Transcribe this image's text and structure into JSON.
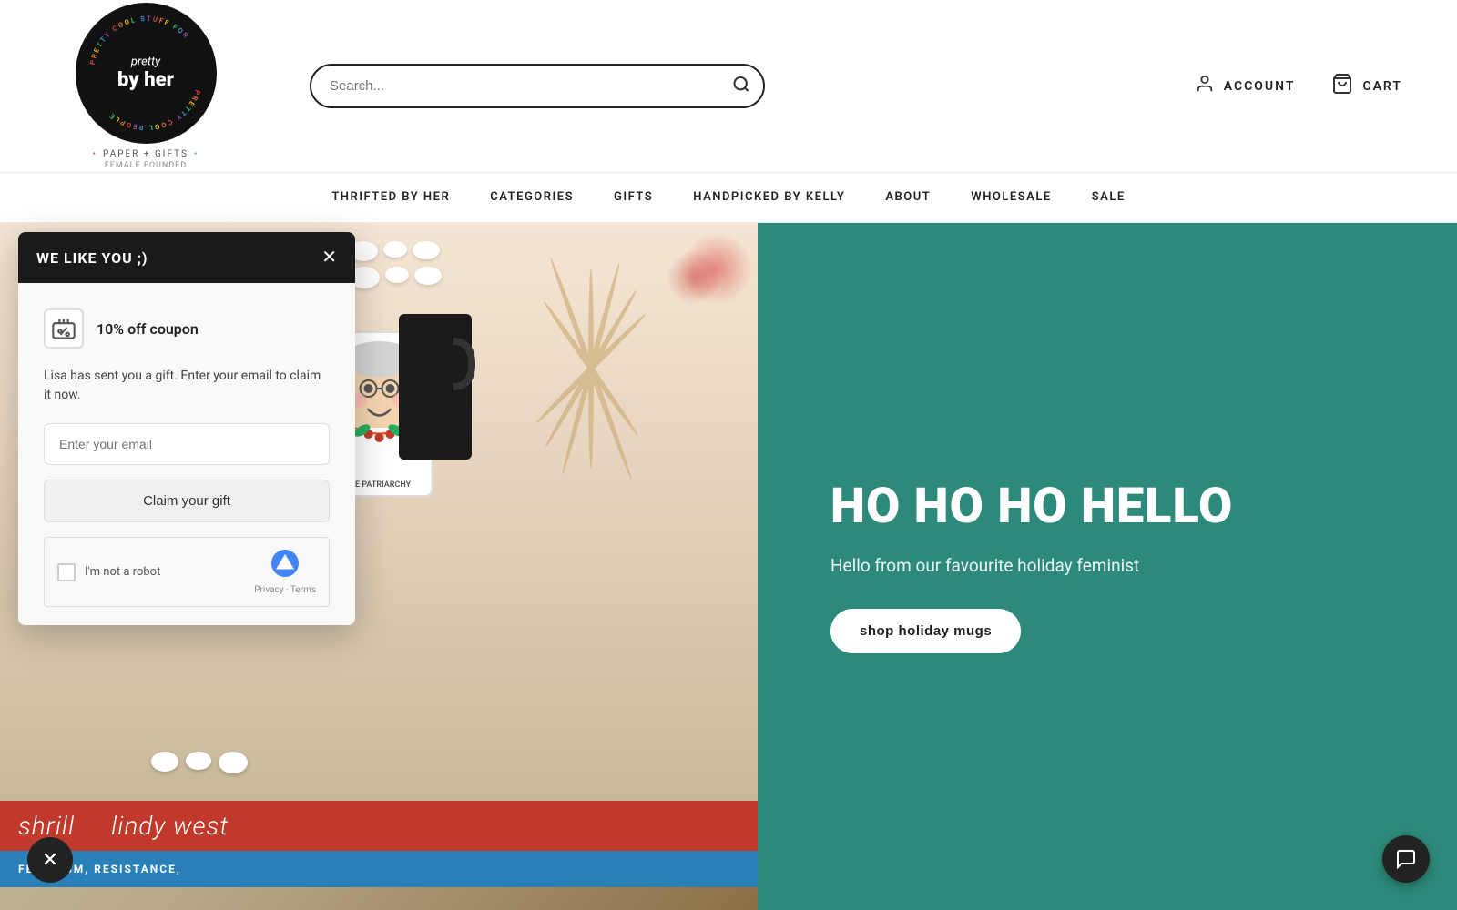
{
  "header": {
    "logo": {
      "pretty": "pretty",
      "byher": "by her",
      "tagline": "PAPER + GIFTS",
      "founded": "FEMALE FOUNDED",
      "ring_text": "PRETTY COOL STUFF FOR PRETTY COOL PEOPLE"
    },
    "search": {
      "placeholder": "Search..."
    },
    "account_label": "ACCOUNT",
    "cart_label": "CART"
  },
  "nav": {
    "items": [
      {
        "label": "THRIFTED BY HER",
        "id": "thrifted-by-her"
      },
      {
        "label": "CATEGORIES",
        "id": "categories"
      },
      {
        "label": "GIFTS",
        "id": "gifts"
      },
      {
        "label": "HANDPICKED BY KELLY",
        "id": "handpicked-by-kelly"
      },
      {
        "label": "ABOUT",
        "id": "about"
      },
      {
        "label": "WHOLESALE",
        "id": "wholesale"
      },
      {
        "label": "SALE",
        "id": "sale"
      }
    ]
  },
  "popup": {
    "title": "WE LIKE YOU ;)",
    "coupon_icon": "🏷️",
    "coupon_label": "10% off coupon",
    "description": "Lisa has sent you a gift. Enter your email to claim it now.",
    "email_placeholder": "Enter your email",
    "claim_button": "Claim your gift",
    "recaptcha_text": "I'm not a robot",
    "recaptcha_privacy": "Privacy",
    "recaptcha_terms": "Terms"
  },
  "hero": {
    "heading": "HO HO HO HELLO",
    "subheading": "Hello from our favourite holiday feminist",
    "cta_label": "shop holiday mugs",
    "book1": "shrill",
    "book1_author": "lindy west",
    "book2_text": "FEMINISM, RESISTANCE,"
  },
  "colors": {
    "teal": "#2d8a7a",
    "black": "#1a1a1a",
    "white": "#ffffff"
  }
}
